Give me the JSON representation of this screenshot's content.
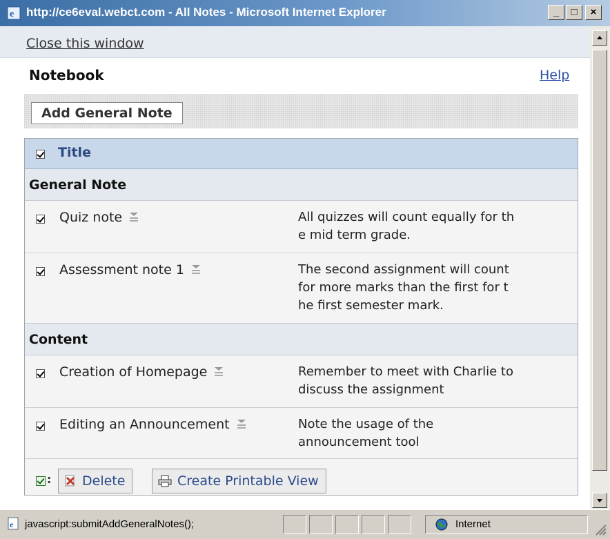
{
  "window": {
    "title": "http://ce6eval.webct.com - All Notes - Microsoft Internet Explorer",
    "minimize": "_",
    "maximize": "□",
    "close": "×"
  },
  "page": {
    "close_link": "Close this window",
    "title": "Notebook",
    "help_link": "Help",
    "add_button": "Add General Note"
  },
  "table": {
    "header": "Title",
    "groups": [
      {
        "name": "General Note",
        "items": [
          {
            "title": "Quiz note",
            "description": "All quizzes will count equally for th\ne mid term grade.",
            "checked": true
          },
          {
            "title": "Assessment note 1",
            "description": "The second assignment will count\nfor more marks than the first for t\nhe first semester mark.",
            "checked": true
          }
        ]
      },
      {
        "name": "Content",
        "items": [
          {
            "title": "Creation of Homepage",
            "description": "Remember to meet with Charlie to\ndiscuss the assignment",
            "checked": true
          },
          {
            "title": "Editing an Announcement",
            "description": "Note the usage of the\nannouncement tool",
            "checked": true
          }
        ]
      }
    ]
  },
  "actions": {
    "delete": "Delete",
    "printable": "Create Printable View"
  },
  "statusbar": {
    "text": "javascript:submitAddGeneralNotes();",
    "zone": "Internet"
  },
  "icons": {
    "app": "ie-icon",
    "note": "note-icon",
    "delete": "delete-icon",
    "print": "print-icon",
    "zone": "globe-icon"
  }
}
